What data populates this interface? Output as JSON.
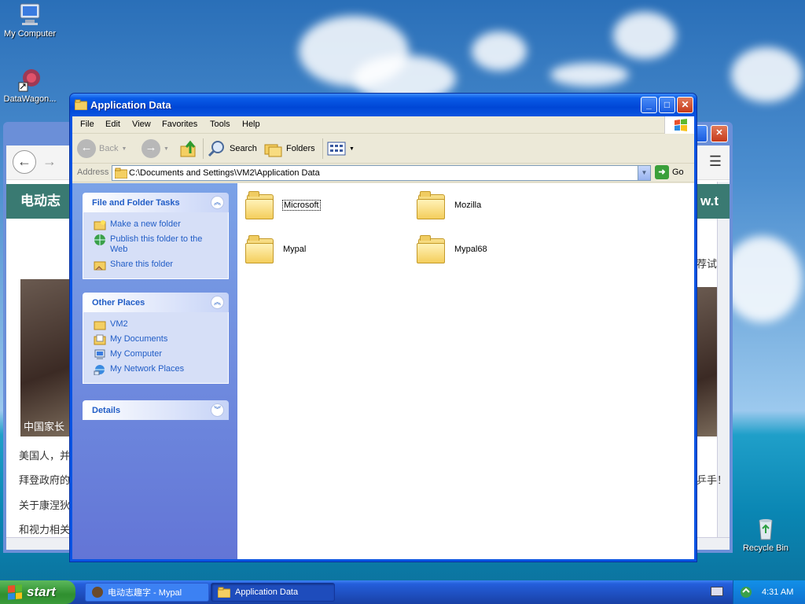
{
  "desktop": {
    "icons": [
      {
        "label": "My Computer"
      },
      {
        "label": "DataWagon..."
      },
      {
        "label": "Recycle Bin"
      }
    ]
  },
  "background_browser": {
    "banner_text": "电动志",
    "banner_right": "w.t",
    "side_text": "荐试",
    "caption": "中国家长",
    "lines": [
      "美国人，并",
      "拜登政府的",
      "关于康涅狄",
      "和视力相关"
    ],
    "right_fragment": "乒手！"
  },
  "window": {
    "title": "Application Data",
    "menu": [
      "File",
      "Edit",
      "View",
      "Favorites",
      "Tools",
      "Help"
    ],
    "toolbar": {
      "back_label": "Back",
      "search_label": "Search",
      "folders_label": "Folders"
    },
    "address": {
      "label": "Address",
      "value": "C:\\Documents and Settings\\VM2\\Application Data",
      "go_label": "Go"
    },
    "task_pane": {
      "file_tasks": {
        "title": "File and Folder Tasks",
        "items": [
          "Make a new folder",
          "Publish this folder to the Web",
          "Share this folder"
        ]
      },
      "other_places": {
        "title": "Other Places",
        "items": [
          "VM2",
          "My Documents",
          "My Computer",
          "My Network Places"
        ]
      },
      "details": {
        "title": "Details"
      }
    },
    "folders": [
      {
        "name": "Microsoft"
      },
      {
        "name": "Mozilla"
      },
      {
        "name": "Mypal"
      },
      {
        "name": "Mypal68"
      }
    ]
  },
  "taskbar": {
    "start_label": "start",
    "buttons": [
      {
        "label": "电动志趣字 - Mypal"
      },
      {
        "label": "Application Data"
      }
    ],
    "clock": "4:31 AM"
  }
}
